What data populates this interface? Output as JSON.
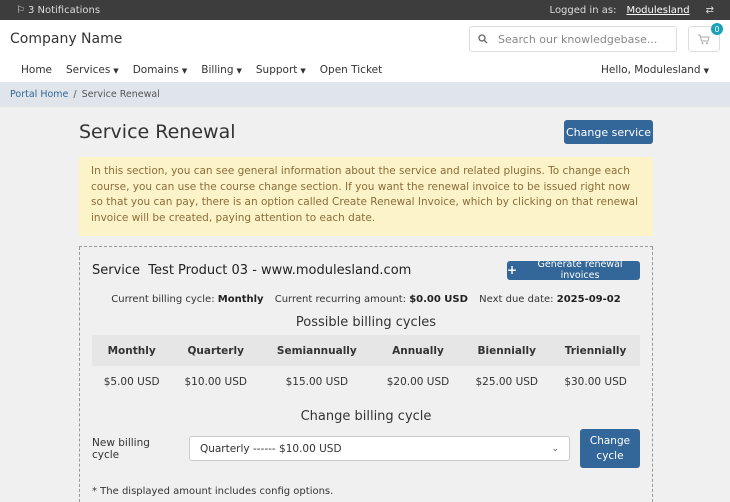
{
  "topbar": {
    "notifications": "3 Notifications",
    "logged_in_label": "Logged in as:",
    "username": "Modulesland"
  },
  "header": {
    "brand": "Company Name",
    "search_placeholder": "Search our knowledgebase...",
    "cart_count": "0"
  },
  "nav": {
    "items": [
      {
        "label": "Home",
        "dropdown": false
      },
      {
        "label": "Services",
        "dropdown": true
      },
      {
        "label": "Domains",
        "dropdown": true
      },
      {
        "label": "Billing",
        "dropdown": true
      },
      {
        "label": "Support",
        "dropdown": true
      },
      {
        "label": "Open Ticket",
        "dropdown": false
      }
    ],
    "greeting": "Hello, Modulesland"
  },
  "breadcrumb": {
    "home": "Portal Home",
    "current": "Service Renewal"
  },
  "page": {
    "title": "Service Renewal",
    "change_service_label": "Change service",
    "alert": "In this section, you can see general information about the service and related plugins. To change each course, you can use the course change section. If you want the renewal invoice to be issued right now so that you can pay, there is an option called Create Renewal Invoice, which by clicking on that renewal invoice will be created, paying attention to each date."
  },
  "service": {
    "title": "Service  Test Product 03 - www.modulesland.com",
    "generate_label": "Generate renewal invoices",
    "billing_cycle_label": "Current billing cycle:",
    "billing_cycle_value": "Monthly",
    "recurring_label": "Current recurring amount:",
    "recurring_value": "$0.00 USD",
    "due_label": "Next due date:",
    "due_value": "2025-09-02"
  },
  "cycles": {
    "title": "Possible billing cycles",
    "headers": [
      "Monthly",
      "Quarterly",
      "Semiannually",
      "Annually",
      "Biennially",
      "Triennially"
    ],
    "prices": [
      "$5.00 USD",
      "$10.00 USD",
      "$15.00 USD",
      "$20.00 USD",
      "$25.00 USD",
      "$30.00 USD"
    ]
  },
  "change": {
    "title": "Change billing cycle",
    "label": "New billing cycle",
    "selected": "Quarterly ------ $10.00 USD",
    "button_line1": "Change",
    "button_line2": "cycle"
  },
  "note": "* The displayed amount includes config options.",
  "colors": {
    "primary": "#336699",
    "alert_bg": "#fdf3c8",
    "alert_text": "#8a6d3b",
    "topbar": "#3d3d3d",
    "badge": "#17a2b8"
  }
}
